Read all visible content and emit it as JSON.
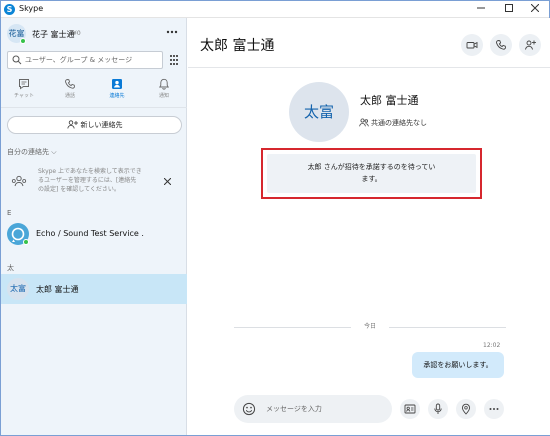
{
  "window": {
    "title": "Skype"
  },
  "profile": {
    "name": "花子 富士通",
    "credit": "¥0",
    "avatar_initials": "花富"
  },
  "search": {
    "placeholder": "ユーザー、グループ & メッセージ"
  },
  "nav_tabs": [
    {
      "label": "チャット",
      "icon": "chat-icon"
    },
    {
      "label": "通話",
      "icon": "phone-icon"
    },
    {
      "label": "連絡先",
      "icon": "contacts-icon"
    },
    {
      "label": "通知",
      "icon": "bell-icon"
    }
  ],
  "new_contact_label": "新しい連絡先",
  "my_contacts_header": "自分の連絡先 ⌵",
  "tip": {
    "lines": [
      "Skype 上であなたを検索して表示でき",
      "るユーザーを管理するには、[連絡先",
      "の設定] を確認してください。"
    ]
  },
  "groups": [
    {
      "letter": "E",
      "contacts": [
        {
          "name": "Echo / Sound Test Service .",
          "avatar": "echo-bot"
        }
      ]
    },
    {
      "letter": "太",
      "contacts": [
        {
          "name": "太郎 富士通",
          "initials": "太富",
          "selected": true
        }
      ]
    }
  ],
  "conversation": {
    "title": "太郎 富士通",
    "contact_name": "太郎 富士通",
    "avatar_initials": "太富",
    "mutual_contacts": "共通の連絡先なし",
    "pending_lines": [
      "太郎 さんが招待を承諾するのを待ってい",
      "ます。"
    ],
    "date_label": "今日",
    "messages": [
      {
        "time": "12:02",
        "text": "承認をお願いします。"
      }
    ],
    "composer_placeholder": "メッセージを入力"
  },
  "colors": {
    "accent": "#0a7ad6",
    "selected_row": "#c8e6f7",
    "highlight_border": "#d6272e",
    "bubble": "#d2eafb"
  }
}
